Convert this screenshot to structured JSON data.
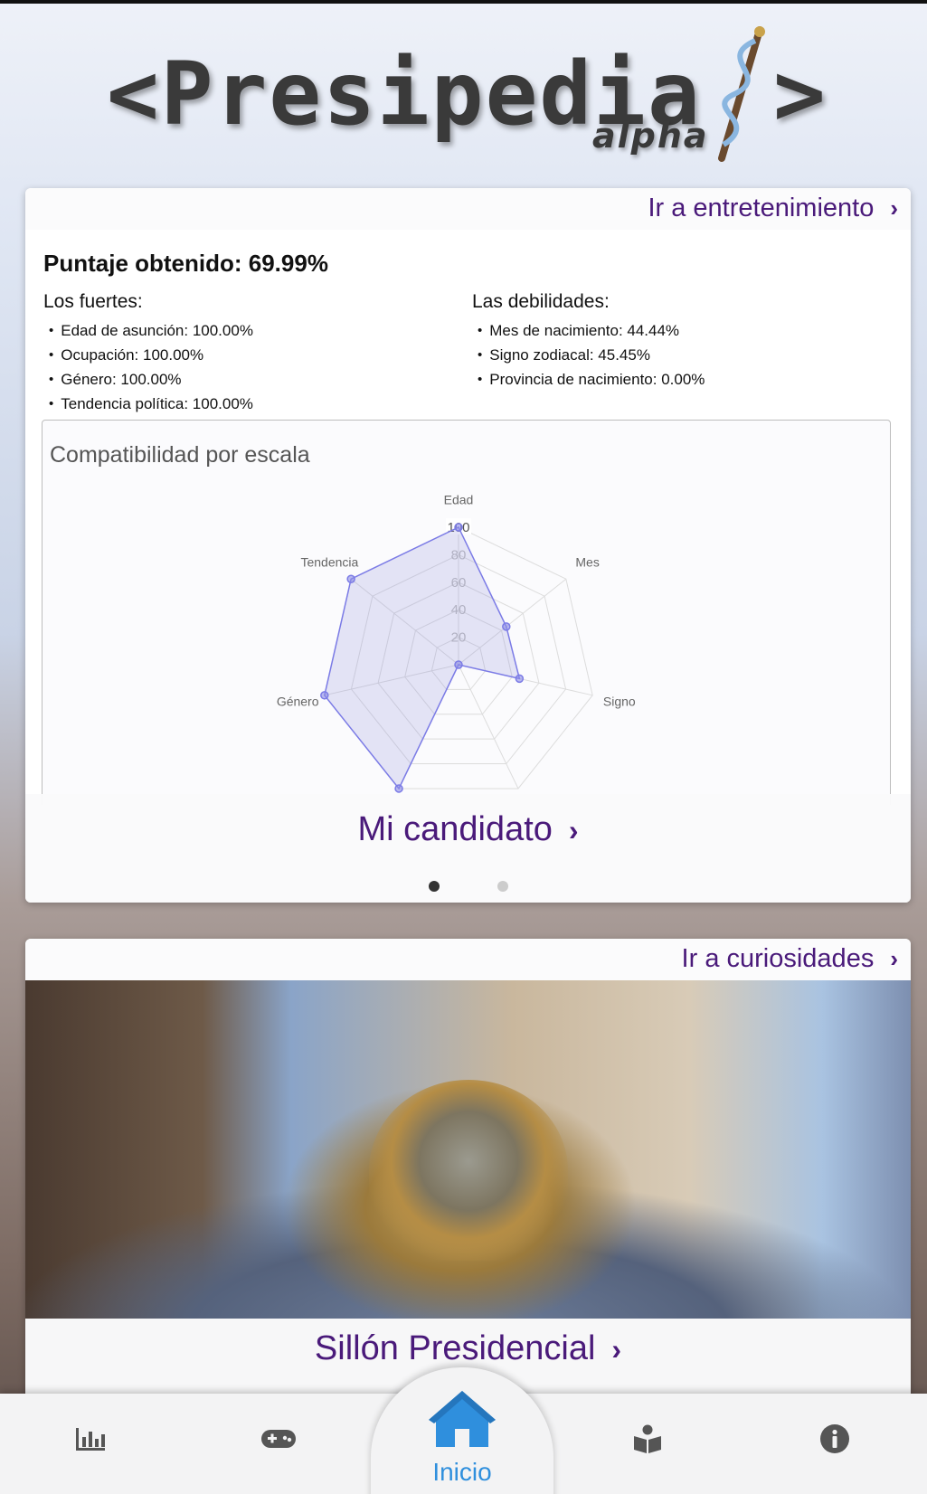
{
  "logo": {
    "name": "<Presipedia",
    "suffix": "alpha",
    "close": ">"
  },
  "card_compat": {
    "link_label": "Ir a entretenimiento",
    "score": "Puntaje obtenido: 69.99%",
    "strengths_title": "Los fuertes:",
    "strengths": [
      "Edad de asunción: 100.00%",
      "Ocupación: 100.00%",
      "Género: 100.00%",
      "Tendencia política: 100.00%"
    ],
    "weaknesses_title": "Las debilidades:",
    "weaknesses": [
      "Mes de nacimiento: 44.44%",
      "Signo zodiacal: 45.45%",
      "Provincia de nacimiento: 0.00%"
    ],
    "footer_title": "Mi candidato",
    "carousel_active": 0,
    "carousel_count": 2
  },
  "chart_data": {
    "type": "radar",
    "title": "Compatibilidad por escala",
    "axes": [
      "Edad",
      "Mes",
      "Signo",
      "",
      "",
      "Género",
      "Tendencia"
    ],
    "values": [
      100,
      44.44,
      45.45,
      0,
      100,
      100,
      100
    ],
    "r_ticks": [
      20,
      40,
      60,
      80,
      100
    ],
    "r_range": [
      0,
      100
    ],
    "colors": {
      "line": "#7b7be6",
      "fill": "rgba(140,140,220,0.22)",
      "grid": "#dcdcdc"
    }
  },
  "card_curio": {
    "link_label": "Ir a curiosidades",
    "footer_title": "Sillón Presidencial"
  },
  "nav": {
    "home_label": "Inicio",
    "items": [
      "stats-icon",
      "gamepad-icon",
      "home-icon",
      "book-reader-icon",
      "info-icon"
    ],
    "accent": "#2f8fdd"
  }
}
